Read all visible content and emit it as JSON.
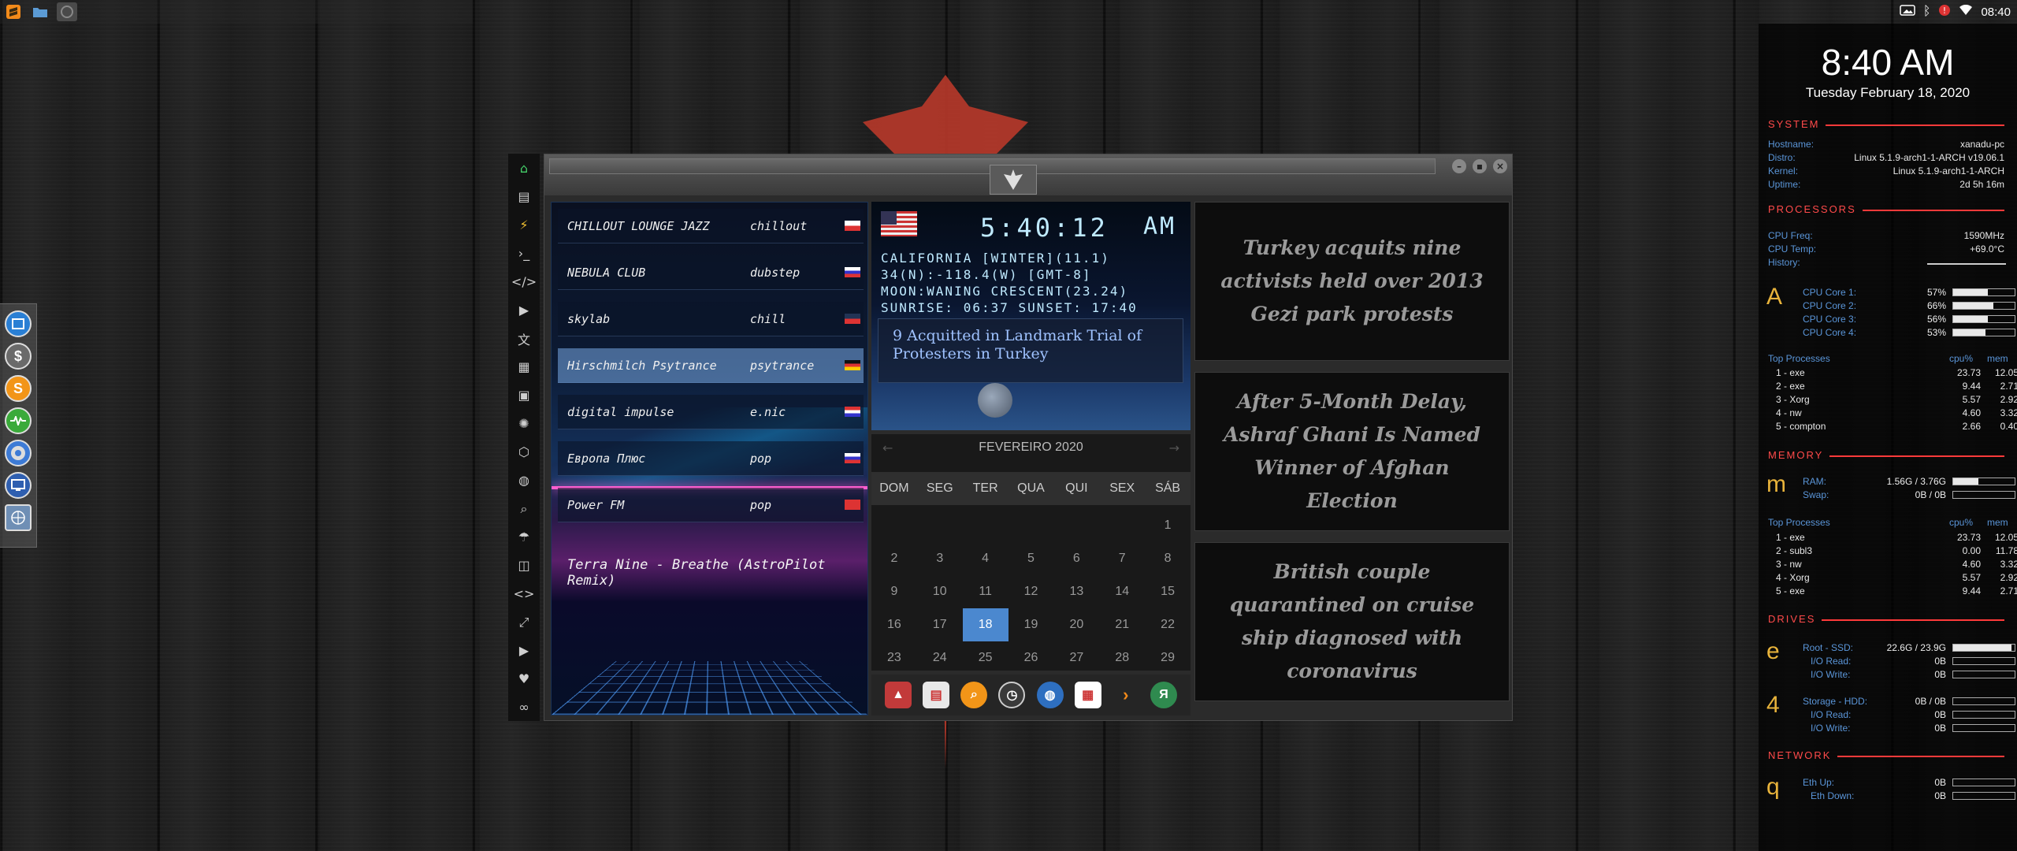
{
  "tray": {
    "clock": "08:40"
  },
  "radio": {
    "stations": [
      {
        "name": "CHILLOUT LOUNGE JAZZ",
        "genre": "chillout",
        "flag": "poland"
      },
      {
        "name": "NEBULA CLUB",
        "genre": "dubstep",
        "flag": "russia"
      },
      {
        "name": "skylab",
        "genre": "chill",
        "flag": "uk"
      },
      {
        "name": "Hirschmilch Psytrance",
        "genre": "psytrance",
        "flag": "germany"
      },
      {
        "name": "digital impulse",
        "genre": "e.nic",
        "flag": "paraguay"
      },
      {
        "name": "Европа Плюс",
        "genre": "pop",
        "flag": "russia"
      },
      {
        "name": "Power FM",
        "genre": "pop",
        "flag": "turkey"
      }
    ],
    "selected_index": 3,
    "now_playing": "Terra Nine - Breathe (AstroPilot Remix)"
  },
  "clock_widget": {
    "time": "5:40:12",
    "ampm": "AM",
    "line1": "CALIFORNIA [WINTER](11.1)",
    "line2": "34(N):-118.4(W) [GMT-8]",
    "line3": "MOON:WANING CRESCENT(23.24)",
    "line4": "SUNRISE: 06:37 SUNSET: 17:40",
    "news": "9 Acquitted in Landmark Trial of Protesters in Turkey"
  },
  "calendar": {
    "month": "FEVEREIRO 2020",
    "days": [
      "DOM",
      "SEG",
      "TER",
      "QUA",
      "QUI",
      "SEX",
      "SÁB"
    ],
    "today": "18",
    "cells": [
      "",
      "",
      "",
      "",
      "",
      "",
      "1",
      "2",
      "3",
      "4",
      "5",
      "6",
      "7",
      "8",
      "9",
      "10",
      "11",
      "12",
      "13",
      "14",
      "15",
      "16",
      "17",
      "18",
      "19",
      "20",
      "21",
      "22",
      "23",
      "24",
      "25",
      "26",
      "27",
      "28",
      "29"
    ]
  },
  "headlines": [
    "Turkey acquits nine activists held over 2013 Gezi park protests",
    "After 5-Month Delay, Ashraf Ghani Is Named Winner of Afghan Election",
    "British couple quarantined on cruise ship diagnosed with coronavirus"
  ],
  "conky": {
    "time": "8:40 AM",
    "date": "Tuesday February 18, 2020",
    "system": {
      "header": "SYSTEM",
      "rows": [
        {
          "k": "Hostname:",
          "v": "xanadu-pc"
        },
        {
          "k": "Distro:",
          "v": "Linux 5.1.9-arch1-1-ARCH v19.06.1"
        },
        {
          "k": "Kernel:",
          "v": "Linux 5.1.9-arch1-1-ARCH"
        },
        {
          "k": "Uptime:",
          "v": "2d 5h 16m"
        }
      ]
    },
    "processors": {
      "header": "PROCESSORS",
      "freq_label": "CPU Freq:",
      "freq": "1590MHz",
      "temp_label": "CPU Temp:",
      "temp": "+69.0°C",
      "history_label": "History:",
      "letter": "A",
      "cores": [
        {
          "k": "CPU Core 1:",
          "v": "57%",
          "pct": 57
        },
        {
          "k": "CPU Core 2:",
          "v": "66%",
          "pct": 66
        },
        {
          "k": "CPU Core 3:",
          "v": "56%",
          "pct": 56
        },
        {
          "k": "CPU Core 4:",
          "v": "53%",
          "pct": 53
        }
      ],
      "top_label": "Top Processes",
      "col_cpu": "cpu%",
      "col_mem": "mem",
      "top": [
        {
          "n": "1 - exe",
          "c": "23.73",
          "m": "12.05"
        },
        {
          "n": "2 - exe",
          "c": "9.44",
          "m": "2.71"
        },
        {
          "n": "3 - Xorg",
          "c": "5.57",
          "m": "2.92"
        },
        {
          "n": "4 - nw",
          "c": "4.60",
          "m": "3.32"
        },
        {
          "n": "5 - compton",
          "c": "2.66",
          "m": "0.40"
        }
      ]
    },
    "memory": {
      "header": "MEMORY",
      "letter": "m",
      "ram_label": "RAM:",
      "ram": "1.56G / 3.76G",
      "ram_pct": 41,
      "swap_label": "Swap:",
      "swap": "0B / 0B",
      "swap_pct": 0,
      "top_label": "Top Processes",
      "col_cpu": "cpu%",
      "col_mem": "mem",
      "top": [
        {
          "n": "1 - exe",
          "c": "23.73",
          "m": "12.05"
        },
        {
          "n": "2 - subl3",
          "c": "0.00",
          "m": "11.78"
        },
        {
          "n": "3 - nw",
          "c": "4.60",
          "m": "3.32"
        },
        {
          "n": "4 - Xorg",
          "c": "5.57",
          "m": "2.92"
        },
        {
          "n": "5 - exe",
          "c": "9.44",
          "m": "2.71"
        }
      ]
    },
    "drives": {
      "header": "DRIVES",
      "d1": {
        "letter": "e",
        "label": "Root - SSD:",
        "value": "22.6G / 23.9G",
        "pct": 95,
        "read_label": "I/O Read:",
        "read": "0B",
        "write_label": "I/O Write:",
        "write": "0B"
      },
      "d2": {
        "letter": "4",
        "label": "Storage - HDD:",
        "value": "0B / 0B",
        "pct": 0,
        "read_label": "I/O Read:",
        "read": "0B",
        "write_label": "I/O Write:",
        "write": "0B"
      }
    },
    "network": {
      "header": "NETWORK",
      "letter": "q",
      "up_label": "Eth Up:",
      "up": "0B",
      "down_label": "Eth Down:",
      "down": "0B"
    }
  }
}
